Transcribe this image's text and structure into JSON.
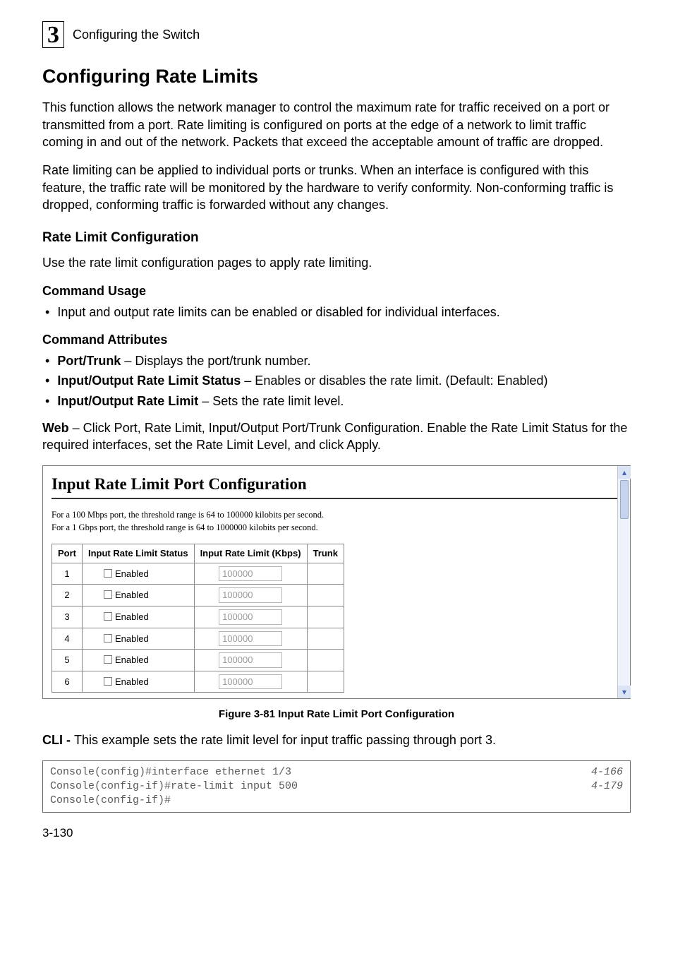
{
  "header": {
    "chapter_number": "3",
    "running_head": "Configuring the Switch"
  },
  "section": {
    "title": "Configuring Rate Limits",
    "para1": "This function allows the network manager to control the maximum rate for traffic received on a port or transmitted from a port. Rate limiting is configured on ports at the edge of a network to limit traffic coming in and out of the network. Packets that exceed the acceptable amount of traffic are dropped.",
    "para2": "Rate limiting can be applied to individual ports or trunks. When an interface is configured with this feature, the traffic rate will be monitored by the hardware to verify conformity. Non-conforming traffic is dropped, conforming traffic is forwarded without any changes."
  },
  "subsection": {
    "title": "Rate Limit Configuration",
    "intro": "Use the rate limit configuration pages to apply rate limiting.",
    "usage_head": "Command Usage",
    "usage_bullet": "Input and output rate limits can be enabled or disabled for individual interfaces.",
    "attrs_head": "Command Attributes",
    "attr1_label": "Port/Trunk",
    "attr1_text": " – Displays the port/trunk number.",
    "attr2_label": "Input/Output Rate Limit Status",
    "attr2_text": " – Enables or disables the rate limit. (Default: Enabled)",
    "attr3_label": "Input/Output Rate Limit",
    "attr3_text": " – Sets the rate limit level.",
    "web_label": "Web",
    "web_text": " – Click Port, Rate Limit, Input/Output Port/Trunk Configuration. Enable the Rate Limit Status for the required interfaces, set the Rate Limit Level, and click Apply."
  },
  "figure": {
    "panel_title": "Input Rate Limit Port Configuration",
    "note1": "For a 100 Mbps port, the threshold range is 64 to 100000 kilobits per second.",
    "note2": "For a 1 Gbps port, the threshold range is 64 to 1000000 kilobits per second.",
    "col_port": "Port",
    "col_status": "Input Rate Limit Status",
    "col_limit": "Input Rate Limit (Kbps)",
    "col_trunk": "Trunk",
    "enabled_label": "Enabled",
    "rows": [
      {
        "port": "1",
        "kbps": "100000"
      },
      {
        "port": "2",
        "kbps": "100000"
      },
      {
        "port": "3",
        "kbps": "100000"
      },
      {
        "port": "4",
        "kbps": "100000"
      },
      {
        "port": "5",
        "kbps": "100000"
      },
      {
        "port": "6",
        "kbps": "100000"
      }
    ],
    "caption": "Figure 3-81  Input Rate Limit Port Configuration"
  },
  "cli": {
    "lead_label": "CLI - ",
    "lead_text": "This example sets the rate limit level for input traffic passing through port 3.",
    "line1_cmd": "Console(config)#interface ethernet 1/3",
    "line1_ref": "4-166",
    "line2_cmd": "Console(config-if)#rate-limit input 500",
    "line2_ref": "4-179",
    "line3_cmd": "Console(config-if)#"
  },
  "footer": {
    "page": "3-130"
  }
}
